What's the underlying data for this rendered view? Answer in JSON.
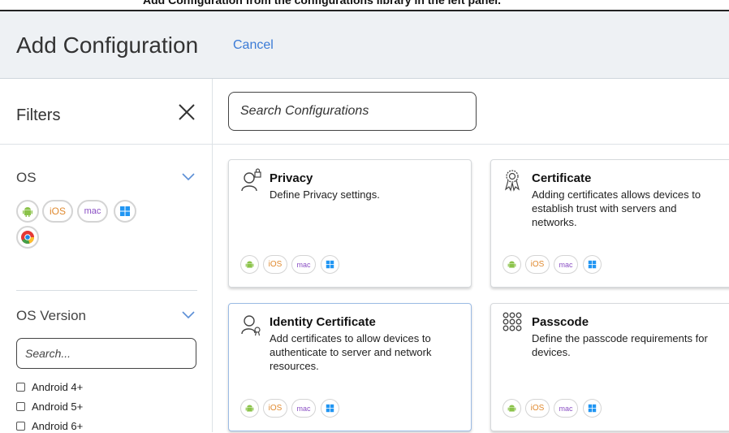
{
  "window": {
    "cropped_top_text": "Add Configuration from the configurations library in the left panel."
  },
  "header": {
    "title": "Add Configuration",
    "cancel_label": "Cancel"
  },
  "sidebar": {
    "heading": "Filters",
    "os": {
      "title": "OS",
      "buttons": [
        "android-icon",
        "iOS",
        "mac",
        "windows-icon",
        "chrome-icon"
      ]
    },
    "os_version": {
      "title": "OS Version",
      "search_placeholder": "Search...",
      "options": [
        "Android 4+",
        "Android 5+",
        "Android 6+"
      ]
    }
  },
  "main": {
    "search_placeholder": "Search Configurations",
    "cards": [
      {
        "title": "Privacy",
        "description": "Define Privacy settings.",
        "icon": "privacy-icon",
        "platforms": [
          "android",
          "iOS",
          "mac",
          "windows"
        ]
      },
      {
        "title": "Certificate",
        "description": "Adding certificates allows devices to establish trust with servers and networks.",
        "icon": "certificate-icon",
        "platforms": [
          "android",
          "iOS",
          "mac",
          "windows"
        ]
      },
      {
        "title": "Identity Certificate",
        "description": "Add certificates to allow devices to authenticate to server and network resources.",
        "icon": "identity-certificate-icon",
        "platforms": [
          "android",
          "iOS",
          "mac",
          "windows"
        ]
      },
      {
        "title": "Passcode",
        "description": "Define the passcode requirements for devices.",
        "icon": "passcode-icon",
        "platforms": [
          "android",
          "iOS",
          "mac",
          "windows"
        ]
      }
    ]
  },
  "colors": {
    "link": "#3b7bd6",
    "ios": "#e08a2f",
    "mac": "#8a4fc4",
    "android": "#8bc34a",
    "windows": "#2196f3",
    "header_bg": "#eef1f4"
  }
}
